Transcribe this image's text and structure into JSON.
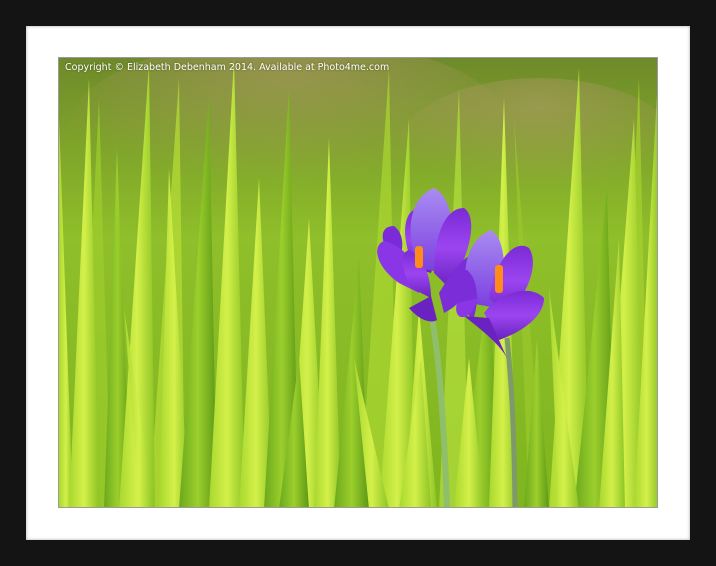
{
  "watermark": {
    "text": "Copyright © Elizabeth Debenham 2014. Available at Photo4me.com"
  },
  "photo": {
    "subject": "two purple crocus flowers among green grass",
    "colors": {
      "frame": "#141414",
      "mat": "#ffffff",
      "grass_light": "#c6e83a",
      "grass_dark": "#4f9a14",
      "petal": "#8a2be2",
      "petal_dark": "#5a1a9e",
      "stamen": "#ff8c1a"
    }
  }
}
